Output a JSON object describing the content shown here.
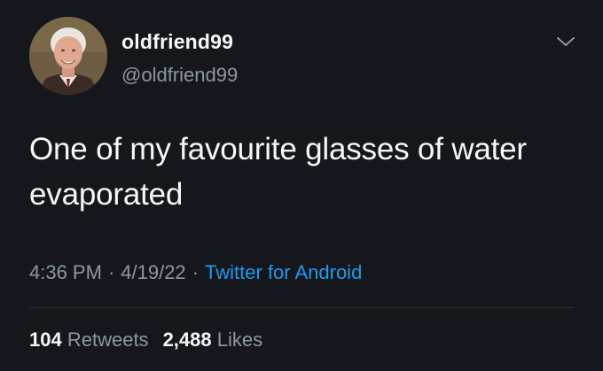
{
  "user": {
    "display_name": "oldfriend99",
    "handle": "@oldfriend99",
    "avatar_icon": "profile-photo-icon"
  },
  "tweet": {
    "text": "One of my favourite glasses of water evaporated",
    "time": "4:36 PM",
    "date": "4/19/22",
    "source": "Twitter for Android",
    "separator": "·"
  },
  "stats": {
    "retweets_count": "104",
    "retweets_label": "Retweets",
    "likes_count": "2,488",
    "likes_label": "Likes"
  },
  "colors": {
    "background": "#15171c",
    "primary_text": "#f5f7f9",
    "secondary_text": "#8b98a5",
    "link": "#1d9bf0",
    "divider": "#2f3336"
  },
  "menu_icon": "chevron-down-icon"
}
